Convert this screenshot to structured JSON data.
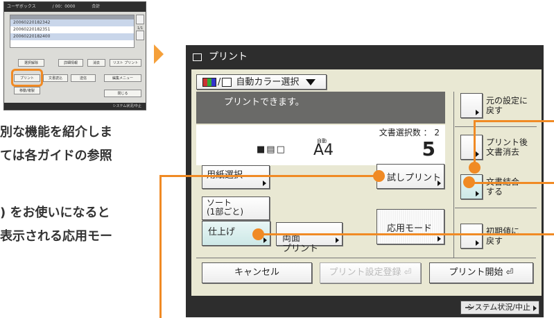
{
  "thumbnail": {
    "header": [
      "ユーザボックス",
      "/ 00：0000",
      "合計"
    ],
    "rows": [
      "20060220182342",
      "20060220182351",
      "20060220182400"
    ],
    "pager": "1/1",
    "buttons": {
      "select_all": "選択解除",
      "details": "詳細情報",
      "erase": "消去",
      "list_print": "リスト プリント",
      "print": "プリント",
      "scan": "文書読込",
      "send": "送信",
      "edit_menu": "編集メニュー",
      "move_copy": "移動/複製",
      "close": "閉じる"
    },
    "footer": "システム状況/中止"
  },
  "description": {
    "line1": "別な機能を紹介しま",
    "line2": "ては各ガイドの参照",
    "line3": ") をお使いになると",
    "line4": "表示される応用モー"
  },
  "screen": {
    "title": "プリント",
    "color_mode": "自動カラー選択",
    "message": "プリントできます。",
    "doc_selected_label": "文書選択数 ： 2",
    "paper_auto": "自動",
    "paper_size": "A4",
    "copies": "5",
    "paper_select": "用紙選択",
    "trial_print": "試しプリント",
    "sort": "ソート\n(1部ごと)",
    "finishing": "仕上げ",
    "duplex": "両面\nプリント",
    "special_mode": "応用モード",
    "restore_settings": "元の設定に\n戻す",
    "delete_after_print": "プリント後\n文書消去",
    "merge_documents": "文書結合\nする",
    "reset_defaults": "初期値に\n戻す",
    "cancel": "キャンセル",
    "store_settings": "プリント設定登録",
    "start_print": "プリント開始"
  },
  "status_bar": {
    "label": "システム状況/中止"
  },
  "colors": {
    "accent": "#f08a24",
    "title_bar": "#2d2d2d",
    "panel_bg": "#e9e8d3"
  }
}
